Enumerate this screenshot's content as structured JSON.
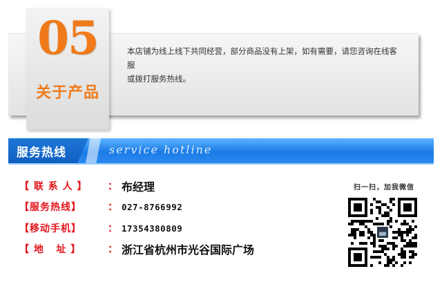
{
  "section": {
    "number": "05",
    "title": "关于产品",
    "notice_line1": "本店铺为线上线下共同经营，部分商品没有上架，如有需要，请您咨询在线客服",
    "notice_line2": "或拨打服务热线。"
  },
  "banner": {
    "title": "服务热线",
    "subtitle": "service hotline"
  },
  "contacts": [
    {
      "label": "【 联 系 人 】",
      "sep": "：",
      "value": "布经理"
    },
    {
      "label": "【服务热线】",
      "sep": "：",
      "value": "027-8766992"
    },
    {
      "label": "【移动手机】",
      "sep": "：",
      "value": "17354380809"
    },
    {
      "label": "【 地   址 】",
      "sep": "：",
      "value": "浙江省杭州市光谷国际广场"
    }
  ],
  "qr": {
    "caption": "扫一扫，加我微信"
  },
  "colors": {
    "accent_orange": "#f07a1a",
    "label_red": "#e2141a",
    "banner_blue": "#1a7be6"
  }
}
